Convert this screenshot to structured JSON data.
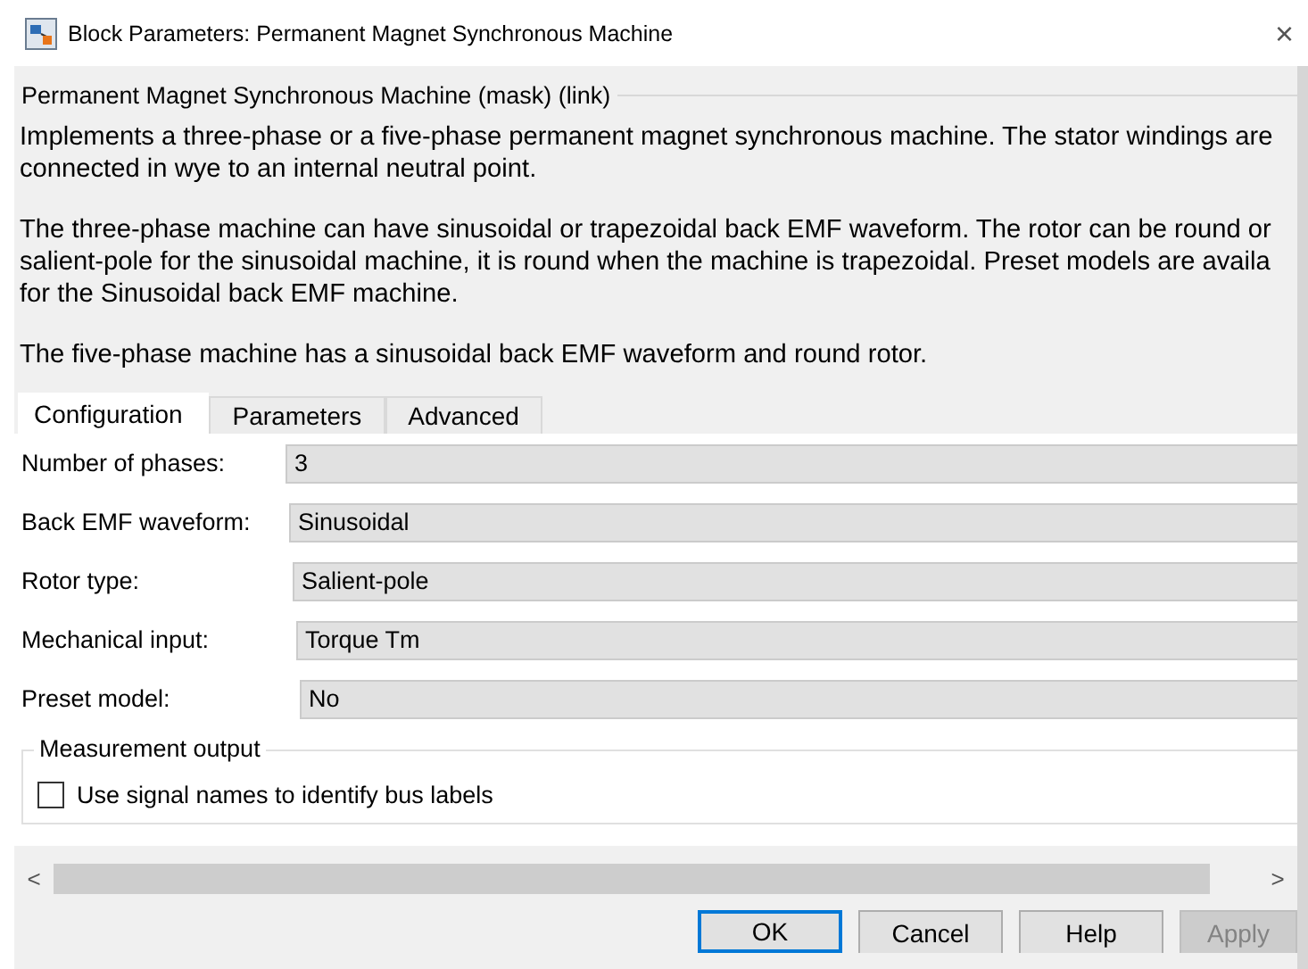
{
  "window": {
    "title": "Block Parameters: Permanent Magnet Synchronous Machine",
    "close": "×"
  },
  "header": "Permanent Magnet Synchronous Machine (mask) (link)",
  "description": [
    {
      "lines": [
        "Implements a three-phase or a five-phase permanent magnet synchronous machine. The stator windings are",
        "connected in wye to an internal neutral point."
      ]
    },
    {
      "lines": [
        "The three-phase machine can have sinusoidal or trapezoidal back EMF waveform. The rotor can be round or",
        "salient-pole for the sinusoidal machine, it is round when the machine is trapezoidal. Preset models are availa",
        "for the Sinusoidal back EMF machine."
      ]
    },
    {
      "lines": [
        "The five-phase machine has a sinusoidal back EMF waveform and round rotor."
      ]
    }
  ],
  "tabs": [
    {
      "label": "Configuration",
      "selected": true
    },
    {
      "label": "Parameters",
      "selected": false
    },
    {
      "label": "Advanced",
      "selected": false
    }
  ],
  "parameters": [
    {
      "label": "Number of phases:",
      "value": "3"
    },
    {
      "label": "Back EMF waveform:",
      "value": "Sinusoidal"
    },
    {
      "label": "Rotor type:",
      "value": "Salient-pole"
    },
    {
      "label": "Mechanical input:",
      "value": "Torque Tm"
    },
    {
      "label": "Preset model:",
      "value": "No"
    }
  ],
  "measurement": {
    "title": "Measurement output",
    "checkbox": {
      "label": "Use signal names to identify bus labels",
      "checked": false
    }
  },
  "scroll": {
    "left": "<",
    "right": ">"
  },
  "buttons": [
    {
      "label": "OK",
      "default": true,
      "disabled": false
    },
    {
      "label": "Cancel",
      "default": false,
      "disabled": false
    },
    {
      "label": "Help",
      "default": false,
      "disabled": false
    },
    {
      "label": "Apply",
      "default": false,
      "disabled": true
    }
  ]
}
